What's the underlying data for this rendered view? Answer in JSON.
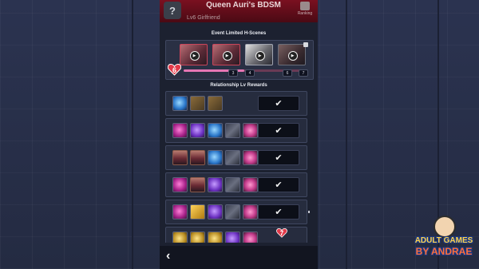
{
  "header": {
    "help_label": "?",
    "character_name": "Queen Auri's BDSM",
    "level_label": "Lv6 Girlfriend",
    "ranking_label": "Ranking"
  },
  "event_section": {
    "title": "Event Limited H-Scenes",
    "current_level": "6",
    "progress": 0.5,
    "milestones": [
      "3",
      "4",
      "6",
      "7"
    ],
    "scenes": [
      {
        "name": "h-scene-1",
        "locked": false
      },
      {
        "name": "h-scene-2",
        "locked": false
      },
      {
        "name": "h-scene-3",
        "locked": false
      },
      {
        "name": "h-scene-4",
        "locked": true
      }
    ]
  },
  "rewards_section": {
    "title": "Relationship Lv Rewards",
    "claimed_mark": "✔",
    "next_level_badge": "7",
    "rows": [
      {
        "items": [
          "gem-blue",
          "ticket",
          "ticket"
        ],
        "claimed": true
      },
      {
        "items": [
          "gem-pink",
          "gem-purple",
          "gem-blue",
          "bow",
          "star"
        ],
        "claimed": true
      },
      {
        "items": [
          "portrait",
          "portrait",
          "gem-blue",
          "bow",
          "star"
        ],
        "claimed": true
      },
      {
        "items": [
          "gem-pink",
          "portrait",
          "gem-purple",
          "bow",
          "star"
        ],
        "claimed": true
      },
      {
        "items": [
          "gem-pink",
          "gold-ticket",
          "gem-purple",
          "bow",
          "star"
        ],
        "claimed": true
      },
      {
        "items": [
          "coin",
          "coin",
          "coin",
          "gem-purple",
          "star"
        ],
        "claimed": false
      }
    ]
  },
  "footer": {
    "back_icon": "‹"
  },
  "watermark": {
    "line1": "ADULT GAMES",
    "line2": "BY ANDRAE"
  }
}
